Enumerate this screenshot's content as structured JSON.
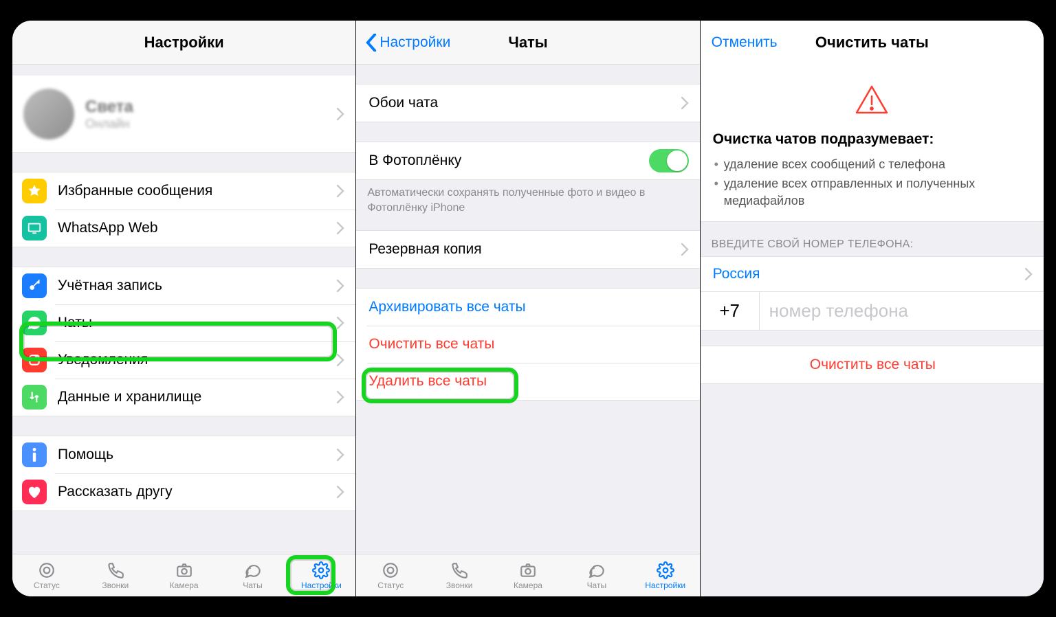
{
  "screen1": {
    "title": "Настройки",
    "profile_name": "Света",
    "profile_status": "Онлайн",
    "rows": {
      "starred": "Избранные сообщения",
      "web": "WhatsApp Web",
      "account": "Учётная запись",
      "chats": "Чаты",
      "notifications": "Уведомления",
      "data": "Данные и хранилище",
      "help": "Помощь",
      "tell": "Рассказать другу"
    }
  },
  "screen2": {
    "back": "Настройки",
    "title": "Чаты",
    "wallpaper": "Обои чата",
    "camera_roll": "В Фотоплёнку",
    "camera_roll_note": "Автоматически сохранять полученные фото и видео в Фотоплёнку iPhone",
    "backup": "Резервная копия",
    "archive_all": "Архивировать все чаты",
    "clear_all": "Очистить все чаты",
    "delete_all": "Удалить все чаты"
  },
  "screen3": {
    "cancel": "Отменить",
    "title": "Очистить чаты",
    "warn_title": "Очистка чатов подразумевает:",
    "bullet1": "удаление всех сообщений с телефона",
    "bullet2": "удаление всех отправленных и полученных медиафайлов",
    "section": "ВВЕДИТЕ СВОЙ НОМЕР ТЕЛЕФОНА:",
    "country": "Россия",
    "code": "+7",
    "placeholder": "номер телефона",
    "action": "Очистить все чаты"
  },
  "tabs": {
    "status": "Статус",
    "calls": "Звонки",
    "camera": "Камера",
    "chats": "Чаты",
    "settings": "Настройки"
  }
}
